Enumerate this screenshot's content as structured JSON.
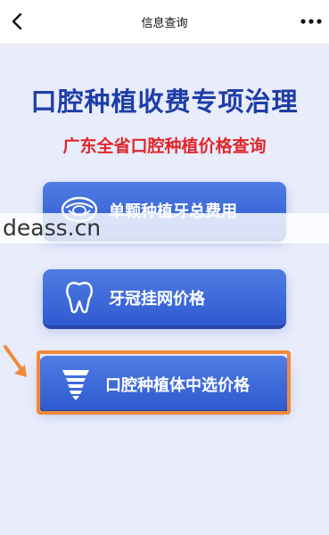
{
  "header": {
    "title": "信息查询"
  },
  "main": {
    "heading": "口腔种植收费专项治理",
    "subheading": "广东全省口腔种植价格查询",
    "buttons": [
      {
        "label": "单颗种植牙总费用",
        "icon": "mouth-icon"
      },
      {
        "label": "牙冠挂网价格",
        "icon": "tooth-icon"
      },
      {
        "label": "口腔种植体中选价格",
        "icon": "implant-screw-icon"
      }
    ]
  },
  "watermark": {
    "text": "deass.cn"
  },
  "colors": {
    "heading": "#1f3da7",
    "subheading": "#e0262a",
    "button": "#3b66d8",
    "highlight": "#f08a3b"
  }
}
